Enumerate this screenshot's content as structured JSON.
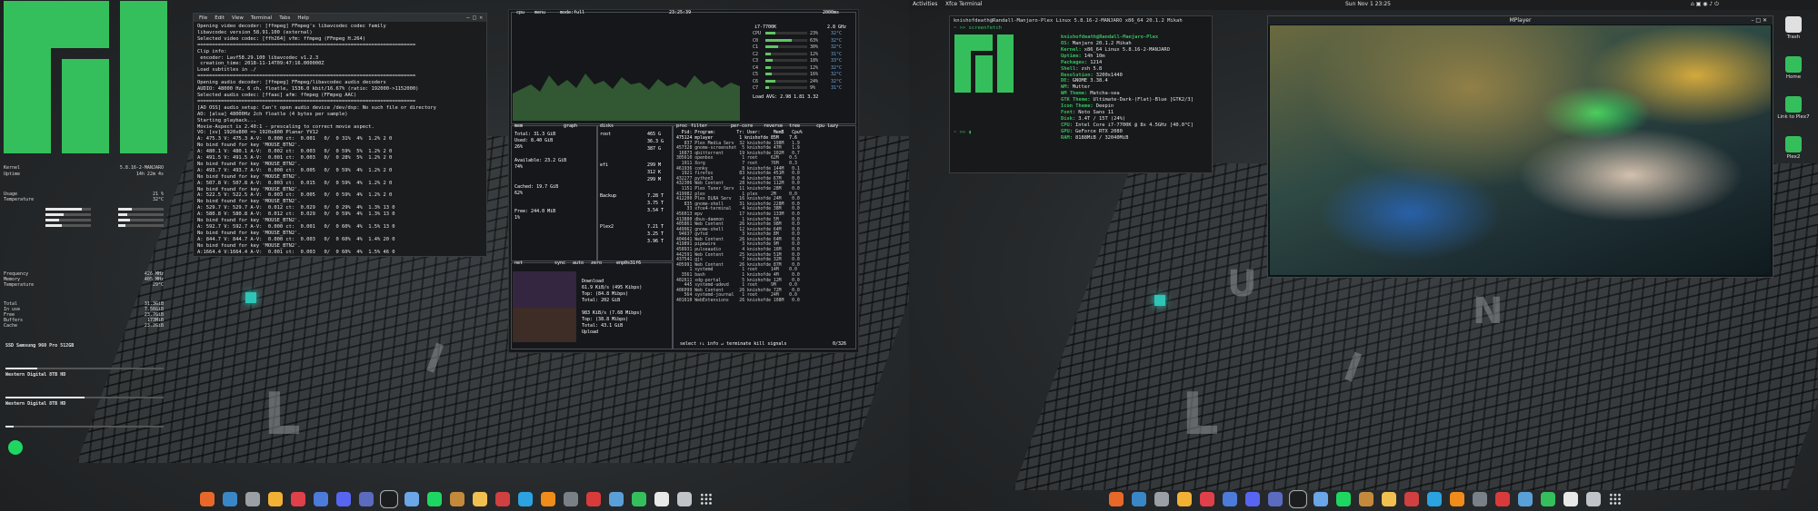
{
  "left_screen": {
    "conky": {
      "system_rows": [
        {
          "label": "Kernel",
          "value": "5.8.16-2-MANJARO"
        },
        {
          "label": "Uptime",
          "value": "14h 22m 4s"
        }
      ],
      "cpu_rows": [
        {
          "label": "Usage",
          "value": "21 %"
        },
        {
          "label": "Temperature",
          "value": "32°C"
        }
      ],
      "memory_rows": [
        {
          "label": "Frequency",
          "value": "426 MHz"
        },
        {
          "label": "Memory",
          "value": "405 MHz"
        },
        {
          "label": "Temperature",
          "value": "29°C"
        }
      ],
      "ram_rows": [
        {
          "label": "Total",
          "value": "31.3GiB"
        },
        {
          "label": "In use",
          "value": "7.56GiB"
        },
        {
          "label": "Free",
          "value": "23.7GiB"
        },
        {
          "label": "Buffers",
          "value": "173MiB"
        },
        {
          "label": "Cache",
          "value": "23.2GiB"
        }
      ],
      "disks": [
        {
          "name": "SSD Samsung 960 Pro 512GB",
          "fill": 0.2
        },
        {
          "name": "Western Digital 8TB HD",
          "fill": 0.5
        },
        {
          "name": "Western Digital 8TB HD",
          "fill": 0.05
        }
      ]
    },
    "terminal": {
      "menu": [
        "File",
        "Edit",
        "View",
        "Terminal",
        "Tabs",
        "Help"
      ],
      "lines": [
        "Opening video decoder: [ffmpeg] FFmpeg's libavcodec codec family",
        "libavcodec version 58.91.100 (external)",
        "Selected video codec: [ffh264] vfm: ffmpeg (FFmpeg H.264)",
        "==========================================================================",
        "Clip info:",
        " encoder: Lavf58.29.100 libavcodec v1.2.3",
        " creation_time: 2018-11-14T09:47:16.000000Z",
        "Load subtitles in ./",
        "==========================================================================",
        "Opening audio decoder: [ffmpeg] FFmpeg/libavcodec audio decoders",
        "AUDIO: 48000 Hz, 6 ch, floatle, 1536.0 kbit/16.67% (ratio: 192000->1152000)",
        "Selected audio codec: [ffaac] afm: ffmpeg (FFmpeg AAC)",
        "==========================================================================",
        "[AO OSS] audio_setup: Can't open audio device /dev/dsp: No such file or directory",
        "AO: [alsa] 48000Hz 2ch floatle (4 bytes per sample)",
        "Starting playback...",
        "Movie-Aspect is 2.40:1 - prescaling to correct movie aspect.",
        "VO: [xv] 1920x800 => 1920x800 Planar YV12",
        "A: 475.3 V: 475.3 A-V:  0.000 ct:  0.001   0/  0 31%  4%  1.2% 2 0",
        "No bind found for key 'MOUSE_BTN2'.",
        "A: 480.1 V: 480.1 A-V:  0.002 ct:  0.003   0/  0 59%  5%  1.2% 2 0",
        "A: 491.5 V: 491.5 A-V:  0.001 ct:  0.003   0/  0 28%  5%  1.2% 2 0",
        "No bind found for key 'MOUSE_BTN2'.",
        "A: 493.7 V: 493.7 A-V:  0.000 ct:  0.005   0/  0 59%  4%  1.2% 2 0",
        "No bind found for key 'MOUSE_BTN2'.",
        "A: 507.8 V: 507.8 A-V:  0.003 ct:  0.015   0/  0 59%  4%  1.2% 2 0",
        "No bind found for key 'MOUSE_BTN2'.",
        "A: 522.5 V: 522.5 A-V:  0.003 ct:  0.005   0/  0 59%  4%  1.2% 2 0",
        "No bind found for key 'MOUSE_BTN2'.",
        "A: 529.7 V: 529.7 A-V:  0.012 ct:  0.029   0/  0 29%  4%  1.3% 13 0",
        "A: 580.8 V: 580.8 A-V:  0.012 ct:  0.029   0/  0 59%  4%  1.3% 13 0",
        "No bind found for key 'MOUSE_BTN2'.",
        "A: 592.7 V: 592.7 A-V:  0.000 ct:  0.001   0/  0 60%  4%  1.5% 13 0",
        "No bind found for key 'MOUSE_BTN2'.",
        "A: 844.7 V: 844.7 A-V:  0.000 ct:  0.003   0/  0 60%  4%  1.4% 20 0",
        "No bind found for key 'MOUSE_BTN2'.",
        "A:1664.4 V:1664.4 A-V:  0.001 ct:  0.003   0/  0 60%  4%  1.5% 46 0"
      ]
    },
    "btop": {
      "header_left": "cpu",
      "header_menu": "menu",
      "header_mode": "mode:full",
      "clock": "23:25:39",
      "refresh": "2000ms",
      "cpu_model": "i7-7700K",
      "cpu_freq": "2.8 GHz",
      "cpu_cores": [
        {
          "label": "CPU",
          "pct": "23%",
          "temp": "32°C",
          "fill": 0.23
        },
        {
          "label": "C0",
          "pct": "63%",
          "temp": "32°C",
          "fill": 0.63
        },
        {
          "label": "C1",
          "pct": "30%",
          "temp": "32°C",
          "fill": 0.3
        },
        {
          "label": "C2",
          "pct": "12%",
          "temp": "31°C",
          "fill": 0.12
        },
        {
          "label": "C3",
          "pct": "18%",
          "temp": "33°C",
          "fill": 0.18
        },
        {
          "label": "C4",
          "pct": "12%",
          "temp": "32°C",
          "fill": 0.12
        },
        {
          "label": "C5",
          "pct": "16%",
          "temp": "32°C",
          "fill": 0.16
        },
        {
          "label": "C6",
          "pct": "24%",
          "temp": "32°C",
          "fill": 0.24
        },
        {
          "label": "C7",
          "pct": "9%",
          "temp": "31°C",
          "fill": 0.09
        }
      ],
      "load_avg": "Load AVG:  2.98   1.81   3.32",
      "mem": {
        "title": "mem",
        "graph_label": "graph",
        "total": "Total: 31.3 GiB",
        "used": "Used: 8.40 GiB",
        "used_pct": "26%",
        "available": "Available: 23.2 GiB",
        "available_pct": "74%",
        "cached": "Cached: 19.7 GiB",
        "cached_pct": "62%",
        "free": "Free: 244.0 MiB",
        "free_pct": "1%"
      },
      "disks": {
        "title": "disks",
        "entries": [
          {
            "name": "root",
            "size": "465 G",
            "used": "36.3 G",
            "free": "387 G"
          },
          {
            "name": "efi",
            "size": "299 M",
            "used": "312 K",
            "free": "299 M"
          },
          {
            "name": "Backup",
            "size": "7.28 T",
            "used": "3.75 T",
            "free": "3.54 T"
          },
          {
            "name": "Plex2",
            "size": "7.21 T",
            "used": "3.25 T",
            "free": "3.96 T"
          }
        ]
      },
      "net": {
        "title": "net",
        "sync": "sync",
        "auto": "auto",
        "zero": "zero",
        "iface": "enp0s31f6",
        "download_label": "Download",
        "dl_rate": "61.9 KiB/s  (495 Kibps)",
        "dl_top": "Top:    (84.8 Mibps)",
        "dl_total": "Total:   202 GiB",
        "upload_label": "Upload",
        "ul_rate": "983 KiB/s  (7.68 Mibps)",
        "ul_top": "Top:    (38.8 Mibps)",
        "ul_total": "Total:   43.1 GiB"
      },
      "proc": {
        "title": "proc",
        "filter": "filter",
        "sort": "per-core",
        "reverse": "reverse",
        "tree": "tree",
        "cpu_lazy": "cpu lazy",
        "header": "  Pid: Program:        Tr: User:     MemB   Cpu%",
        "rows": [
          "475124 mplayer          1 knishofde 85M    7.6",
          "   837 Plex Media Serv  32 knishofde 198M   1.9",
          "457328 gnome-screenshot  5 knishofde 47M    1.9",
          " 16873 qbittorrent      19 knishofde 102M   0.7",
          "305610 openbox           1 root     62M    0.5",
          "  1911 Xorg              7 root     76M    0.3",
          "461936 conky             8 knishofde 144M   0.1",
          "  1921 firefox          83 knishofde 451M   0.0",
          "432277 python3           4 knishofde 67M    0.0",
          "432306 Web Content      28 knishofde 112M   0.0",
          "  1151 Plex Tuner Serv  11 knishofde 28M    0.0",
          "419982 plex              1 plex     2M     0.0",
          "412200 Plex DLNA Serv   16 knishofde 24M    0.0",
          "   835 gnome-shell      31 knishofde 228M   0.0",
          "    33 xfce4-terminal    4 knishofde 38M    0.0",
          "456013 mpv              17 knishofde 133M   0.0",
          "413880 dbus-daemon       1 knishofde 5M     0.0",
          "405861 Web Content      26 knishofde 98M    0.0",
          "449962 gnome-shell      12 knishofde 64M    0.0",
          " 94637 gvfsd             3 knishofde 8M     0.0",
          "404641 Web Content      26 knishofde 64M    0.0",
          "419891 pipewire          3 knishofde 9M     0.0",
          "458931 pulseaudio        4 knishofde 16M    0.0",
          "442591 Web Content      25 knishofde 51M    0.0",
          "437541 gjs               7 knishofde 32M    0.0",
          "405991 Web Content      26 knishofde 87M    0.0",
          "     1 systemd           1 root     14M    0.0",
          "  3561 bash              1 knishofde 4M     0.0",
          "402611 xdg-portal        5 knishofde 12M    0.0",
          "   445 systemd-udevd     1 root     9M     0.0",
          "406099 Web Content      26 knishofde 72M    0.0",
          "   564 systemd-journal   1 root     24M    0.0",
          "401610 WebExtensions    26 knishofde 108M   0.0"
        ],
        "footer": "select ↑↓  info ↵  terminate  kill  signals",
        "count": "0/326"
      }
    }
  },
  "right_screen": {
    "topbar": {
      "activities": "Activities",
      "app": "Xfce Terminal",
      "clock": "Sun Nov 1 23:25"
    },
    "terminal": {
      "title": "knishofdeath@Randall-Manjaro-Plex Linux 5.8.16-2-MANJARO x86_64 20.1.2 Mikah",
      "prompt_cmd": "~ >> screenfetch",
      "user_host": "knishofdeath@Randall-Manjaro-Plex",
      "info": [
        {
          "k": "OS:",
          "v": "Manjaro 20.1.2 Mikah"
        },
        {
          "k": "Kernel:",
          "v": "x86_64 Linux 5.8.16-2-MANJARO"
        },
        {
          "k": "Uptime:",
          "v": "14h 10m"
        },
        {
          "k": "Packages:",
          "v": "1214"
        },
        {
          "k": "Shell:",
          "v": "zsh 5.8"
        },
        {
          "k": "Resolution:",
          "v": "3200x1440"
        },
        {
          "k": "DE:",
          "v": "GNOME 3.38.4"
        },
        {
          "k": "WM:",
          "v": "Mutter"
        },
        {
          "k": "WM Theme:",
          "v": "Matcha-sea"
        },
        {
          "k": "GTK Theme:",
          "v": "Ultimate-Dark-(Flat)-Blue [GTK2/3]"
        },
        {
          "k": "Icon Theme:",
          "v": "Deepin"
        },
        {
          "k": "Font:",
          "v": "Noto Sans 11"
        },
        {
          "k": "Disk:",
          "v": "3.4T / 15T (24%)"
        },
        {
          "k": "CPU:",
          "v": "Intel Core i7-7700K @ 8x 4.5GHz [40.0°C]"
        },
        {
          "k": "GPU:",
          "v": "GeForce RTX 2080"
        },
        {
          "k": "RAM:",
          "v": "8188MiB / 32040MiB"
        }
      ],
      "prompt": "~ >>"
    },
    "mpv": {
      "title": "MPlayer"
    },
    "desktop_icons": [
      {
        "label": "Trash",
        "color": "#e0e0e0"
      },
      {
        "label": "Home",
        "color": "#35bf5c"
      },
      {
        "label": "Link to Plex7",
        "color": "#35bf5c"
      },
      {
        "label": "Plex2",
        "color": "#35bf5c"
      }
    ]
  },
  "dock_colors": [
    "#e8682a",
    "#3a87c7",
    "#9aa0a6",
    "#f2b134",
    "#e0404a",
    "#4c7bd9",
    "#5865f2",
    "#5b6bbf",
    "#1b1d1f",
    "#6aa6e8",
    "#1ed760",
    "#c48a3c",
    "#f0c050",
    "#d04040",
    "#2aa3e0",
    "#ef8c1a",
    "#7a8088",
    "#d93b3b",
    "#5aa0d8",
    "#35bf5c",
    "#e8e8e8",
    "#c0c4c8"
  ],
  "colors": {
    "accent": "#35bf5c",
    "term_bg": "#1a1c1e",
    "conky_pink": "#e0607e"
  }
}
